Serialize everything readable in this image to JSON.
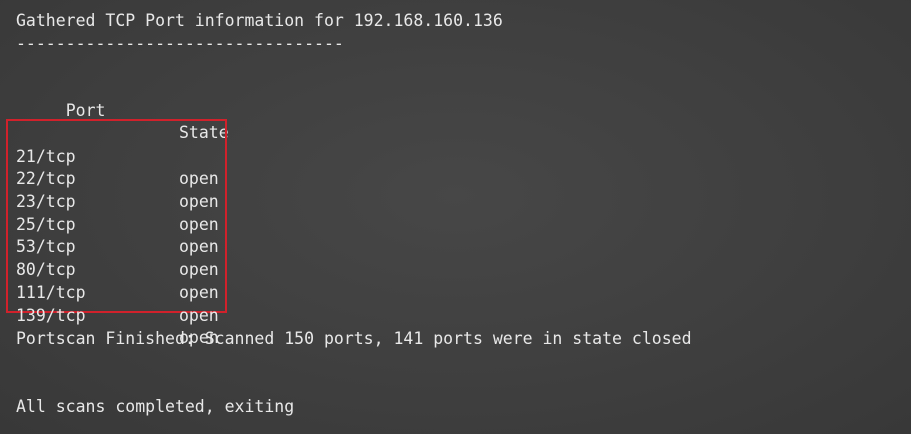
{
  "header": {
    "title": "Gathered TCP Port information for 192.168.160.136",
    "rule": "---------------------------------"
  },
  "columns": {
    "port": "Port",
    "state": "State"
  },
  "ports": [
    {
      "port": "21/tcp",
      "state": "open"
    },
    {
      "port": "22/tcp",
      "state": "open"
    },
    {
      "port": "23/tcp",
      "state": "open"
    },
    {
      "port": "25/tcp",
      "state": "open"
    },
    {
      "port": "53/tcp",
      "state": "open"
    },
    {
      "port": "80/tcp",
      "state": "open"
    },
    {
      "port": "111/tcp",
      "state": "open"
    },
    {
      "port": "139/tcp",
      "state": "open"
    }
  ],
  "summary": "Portscan Finished: Scanned 150 ports, 141 ports were in state closed",
  "exit_message": "All scans completed, exiting",
  "colors": {
    "background": "#424242",
    "text": "#e8e8e8",
    "highlight_box": "#d1212b"
  }
}
